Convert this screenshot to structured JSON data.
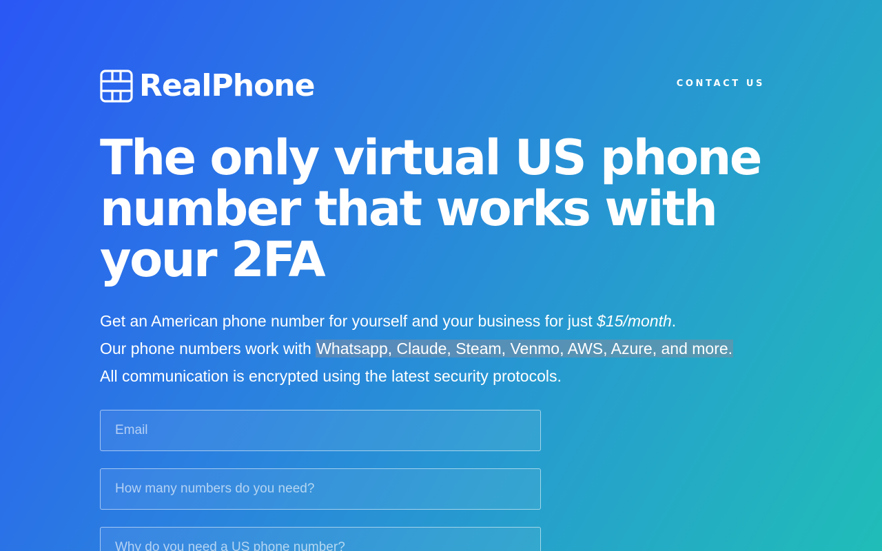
{
  "brand": {
    "name": "RealPhone",
    "icon": "sim-card-grid-icon"
  },
  "nav": {
    "contact_label": "CONTACT US"
  },
  "hero": {
    "headline": "The only virtual US phone number that works with your 2FA",
    "line1_prefix": "Get an American phone number for yourself and your business for just ",
    "line1_price": "$15/month",
    "line1_suffix": ".",
    "line2_prefix": "Our phone numbers work with ",
    "line2_highlight": "Whatsapp, Claude, Steam, Venmo, AWS, Azure, and more.",
    "line3": "All communication is encrypted using the latest security protocols."
  },
  "form": {
    "email_placeholder": "Email",
    "quantity_placeholder": "How many numbers do you need?",
    "reason_placeholder": "Why do you need a US phone number?"
  },
  "colors": {
    "gradient_start": "#2a57f5",
    "gradient_end": "#20bdb8",
    "text": "#ffffff"
  }
}
